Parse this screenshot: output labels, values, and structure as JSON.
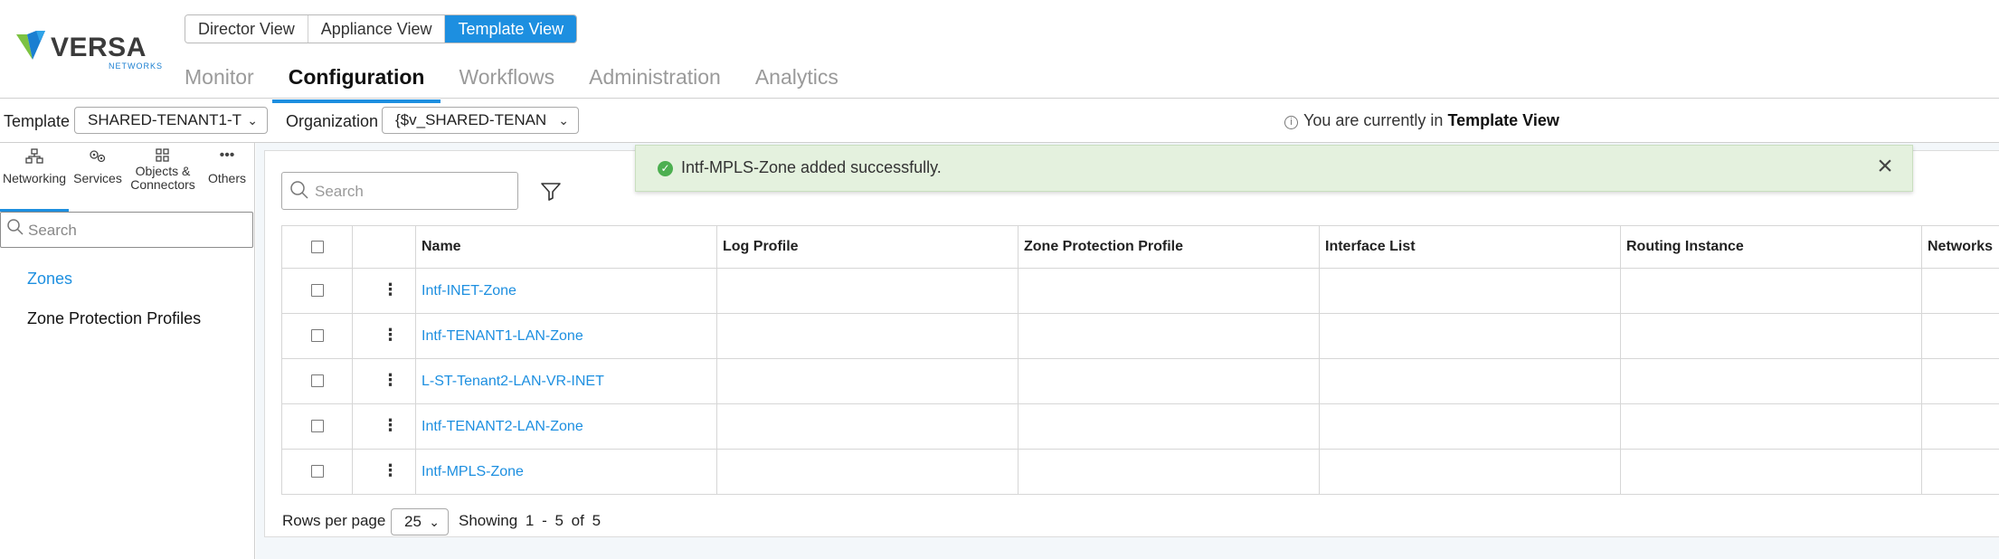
{
  "brand": {
    "name": "VERSA",
    "sub": "NETWORKS"
  },
  "view_switch": [
    "Director View",
    "Appliance View",
    "Template View"
  ],
  "main_nav": [
    "Monitor",
    "Configuration",
    "Workflows",
    "Administration",
    "Analytics"
  ],
  "context": {
    "template_label": "Template",
    "template_value": "SHARED-TENANT1-T",
    "organization_label": "Organization",
    "organization_value": "{$v_SHARED-TENAN",
    "info_prefix": "You are currently in",
    "info_bold": "Template View"
  },
  "categories": [
    {
      "label": "Networking",
      "icon": "networking-icon"
    },
    {
      "label": "Services",
      "icon": "services-icon"
    },
    {
      "label": "Objects & Connectors",
      "icon": "objects-icon"
    },
    {
      "label": "Others",
      "icon": "more-icon"
    }
  ],
  "sidebar": {
    "search_placeholder": "Search",
    "items": [
      "Zones",
      "Zone Protection Profiles"
    ]
  },
  "main": {
    "search_placeholder": "Search",
    "toast": "Intf-MPLS-Zone added successfully.",
    "columns": [
      "Name",
      "Log Profile",
      "Zone Protection Profile",
      "Interface List",
      "Routing Instance",
      "Networks"
    ],
    "rows": [
      "Intf-INET-Zone",
      "Intf-TENANT1-LAN-Zone",
      "L-ST-Tenant2-LAN-VR-INET",
      "Intf-TENANT2-LAN-Zone",
      "Intf-MPLS-Zone"
    ]
  },
  "footer": {
    "rows_per_page_label": "Rows per page",
    "rows_per_page": "25",
    "showing": "Showing 1 - 5 of 5"
  },
  "colors": {
    "accent": "#1d8fe0",
    "toast_bg": "#e4f1de",
    "success": "#4caf50"
  }
}
